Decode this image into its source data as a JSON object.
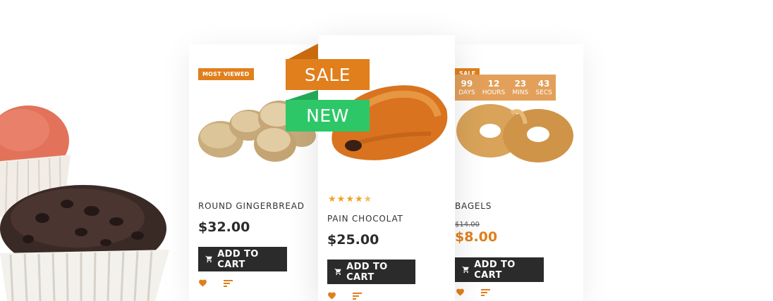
{
  "products": [
    {
      "badge": "MOST VIEWED",
      "name": "ROUND GINGERBREAD",
      "price": "$32.00",
      "button": "ADD TO CART"
    },
    {
      "ribbons": [
        "SALE",
        "NEW"
      ],
      "rating": 4.5,
      "name": "PAIN CHOCOLAT",
      "price": "$25.00",
      "button": "ADD TO CART"
    },
    {
      "badge": "SALE",
      "countdown": [
        {
          "value": "99",
          "label": "DAYS"
        },
        {
          "value": "12",
          "label": "HOURS"
        },
        {
          "value": "23",
          "label": "MINS"
        },
        {
          "value": "43",
          "label": "SECS"
        }
      ],
      "name": "BAGELS",
      "old_price": "$14.00",
      "price": "$8.00",
      "button": "ADD TO CART"
    }
  ],
  "icons": [
    "heart-icon",
    "compare-icon",
    "cart-icon",
    "star-icon"
  ],
  "colors": {
    "accent": "#e07f1c",
    "new_green": "#2ec768",
    "button_dark": "#2b2b2b",
    "timer_bg": "#e3a05a",
    "star": "#f0a21f"
  }
}
